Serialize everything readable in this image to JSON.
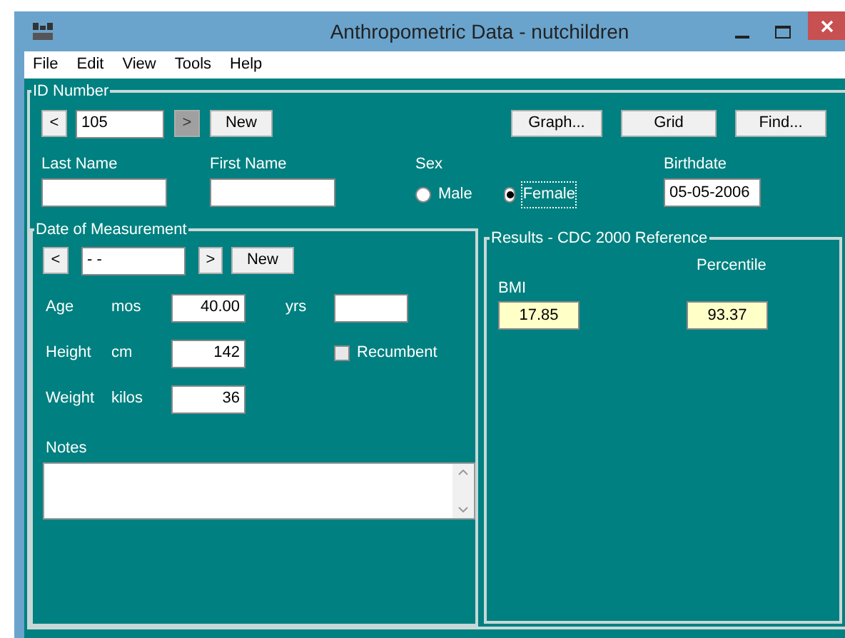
{
  "window": {
    "title": "Anthropometric Data - nutchildren"
  },
  "menu": [
    "File",
    "Edit",
    "View",
    "Tools",
    "Help"
  ],
  "id_group": {
    "title": "ID Number",
    "prev": "<",
    "id_value": "105",
    "next": {
      "label": ">",
      "disabled": true
    },
    "new_button": "New",
    "buttons": [
      "Graph...",
      "Grid",
      "Find..."
    ]
  },
  "last_name": {
    "label": "Last Name"
  },
  "first_name": {
    "label": "First Name"
  },
  "sex": {
    "label": "Sex",
    "options": [
      {
        "label": "Male",
        "selected": false
      },
      {
        "label": "Female",
        "selected": true
      }
    ]
  },
  "birthdate": {
    "label": "Birthdate",
    "value": "05-05-2006"
  },
  "measurement": {
    "title": "Date of Measurement",
    "prev": "<",
    "date_value": "- -",
    "next": ">",
    "new_button": "New",
    "age": {
      "label": "Age",
      "unit": "mos",
      "value": "40.00",
      "years_unit": "yrs"
    },
    "height": {
      "label": "Height",
      "unit": "cm",
      "value": "142",
      "recumbent": {
        "label": "Recumbent",
        "checked": false
      }
    },
    "weight": {
      "label": "Weight",
      "unit": "kilos",
      "value": "36"
    },
    "notes": {
      "label": "Notes"
    }
  },
  "results": {
    "title": "Results - CDC 2000 Reference",
    "bmi": {
      "label": "BMI",
      "value": "17.85"
    },
    "percentile": {
      "label": "Percentile",
      "value": "93.37"
    }
  }
}
